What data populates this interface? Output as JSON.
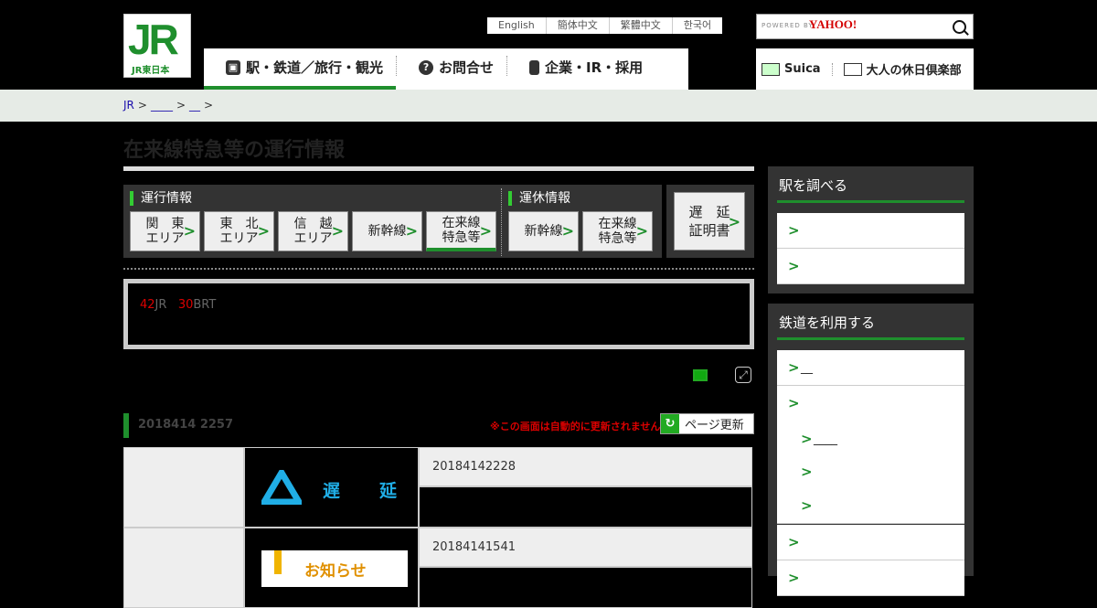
{
  "header": {
    "logo_text": "JR",
    "logo_sub": "JR東日本",
    "languages": [
      "English",
      "簡体中文",
      "繁體中文",
      "한국어"
    ],
    "search_powered": "POWERED BY",
    "search_brand": "YAHOO!",
    "gnav": [
      "駅・鉄道／旅行・観光",
      "お問合せ",
      "企業・IR・採用"
    ],
    "snav": [
      "Suica",
      "大人の休日倶楽部"
    ]
  },
  "breadcrumb": [
    "JR",
    "____",
    "__"
  ],
  "page_title": "在来線特急等の運行情報",
  "tabs": {
    "operation_label": "運行情報",
    "suspension_label": "運休情報",
    "operation": [
      {
        "l1": "関　東",
        "l2": "エリア"
      },
      {
        "l1": "東　北",
        "l2": "エリア"
      },
      {
        "l1": "信　越",
        "l2": "エリア"
      },
      {
        "l1": "新幹線",
        "l2": ""
      },
      {
        "l1": "在来線",
        "l2": "特急等"
      }
    ],
    "suspension": [
      {
        "l1": "新幹線",
        "l2": ""
      },
      {
        "l1": "在来線",
        "l2": "特急等"
      }
    ],
    "delay_cert": {
      "l1": "遅　延",
      "l2": "証明書"
    }
  },
  "notice": {
    "n1": "42",
    "t1": "JR",
    "n2": "30",
    "t2": "BRT"
  },
  "update": {
    "time": "2018414 2257",
    "warning": "※この画面は自動的に更新されません",
    "refresh_label": "ページ更新"
  },
  "status_rows": [
    {
      "type": "delay",
      "status_label": "遅　延",
      "datetime": "20184142228"
    },
    {
      "type": "notice",
      "status_label": "お知らせ",
      "datetime": "20184141541"
    }
  ],
  "sidebar": {
    "station_title": "駅を調べる",
    "rail_title": "鉄道を利用する",
    "rail_items": [
      {
        "label": "__",
        "sub": false
      },
      {
        "label": "",
        "sub": false
      },
      {
        "label": "____",
        "sub": true
      },
      {
        "label": "",
        "sub": true
      },
      {
        "label": "",
        "sub": true
      },
      {
        "label": "",
        "sub": false
      },
      {
        "label": "",
        "sub": false
      }
    ]
  },
  "colors": {
    "accent": "#1f8f2d",
    "delay": "#20aee6",
    "warning": "#dd0000",
    "notice": "#f0b400"
  }
}
